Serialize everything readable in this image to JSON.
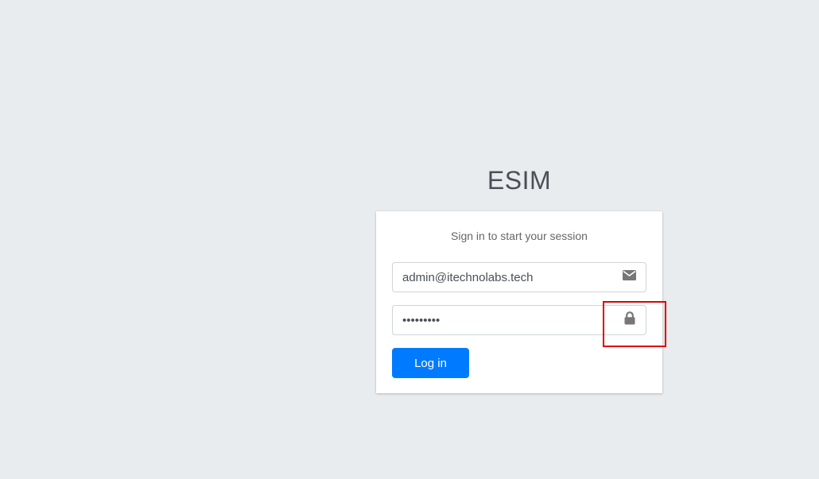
{
  "app": {
    "title": "ESIM"
  },
  "login_box": {
    "message": "Sign in to start your session",
    "email": {
      "value": "admin@itechnolabs.tech",
      "icon": "envelope-icon"
    },
    "password": {
      "value": "•••••••••",
      "icon": "lock-icon"
    },
    "submit_label": "Log in"
  },
  "colors": {
    "background": "#e9ecef",
    "primary": "#007bff",
    "highlight": "#e00000"
  }
}
